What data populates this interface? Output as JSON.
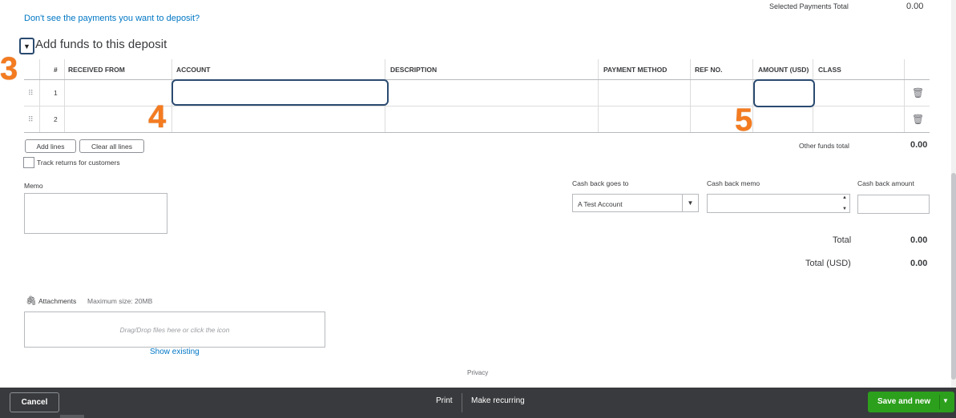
{
  "header": {
    "payments_link": "Don't see the payments you want to deposit?",
    "selected_total_label": "Selected Payments Total",
    "selected_total_value": "0.00"
  },
  "section": {
    "toggle_icon": "triangle-down-icon",
    "toggle_glyph": "▼",
    "title": "Add funds to this deposit"
  },
  "callouts": {
    "three": "3",
    "four": "4",
    "five": "5"
  },
  "table": {
    "columns": [
      "#",
      "RECEIVED FROM",
      "ACCOUNT",
      "DESCRIPTION",
      "PAYMENT METHOD",
      "REF NO.",
      "AMOUNT (USD)",
      "CLASS"
    ],
    "rows": [
      {
        "num": "1"
      },
      {
        "num": "2"
      }
    ],
    "drag_glyph": "⠿",
    "trash_glyph": "🗑"
  },
  "buttons": {
    "add_lines": "Add lines",
    "clear_all_lines": "Clear all lines"
  },
  "track_returns_label": "Track returns for customers",
  "other_funds_label": "Other funds total",
  "other_funds_value": "0.00",
  "memo_label": "Memo",
  "cash_back": {
    "goes_to_label": "Cash back goes to",
    "goes_to_value": "A Test Account",
    "memo_label": "Cash back memo",
    "amount_label": "Cash back amount"
  },
  "totals": {
    "total_label": "Total",
    "total_value": "0.00",
    "total_usd_label": "Total (USD)",
    "total_usd_value": "0.00"
  },
  "attachments": {
    "label": "Attachments",
    "max_size": "Maximum size: 20MB",
    "drop_hint": "Drag/Drop files here or click the icon",
    "show_existing": "Show existing"
  },
  "privacy": "Privacy",
  "footer": {
    "cancel": "Cancel",
    "print": "Print",
    "make_recurring": "Make recurring",
    "save_and_new": "Save and new"
  },
  "colors": {
    "link": "#0077c5",
    "primary_green": "#2ca01c",
    "footer_bg": "#393a3d",
    "callout_orange": "#f47b20",
    "highlight_border": "#2a4a70"
  }
}
